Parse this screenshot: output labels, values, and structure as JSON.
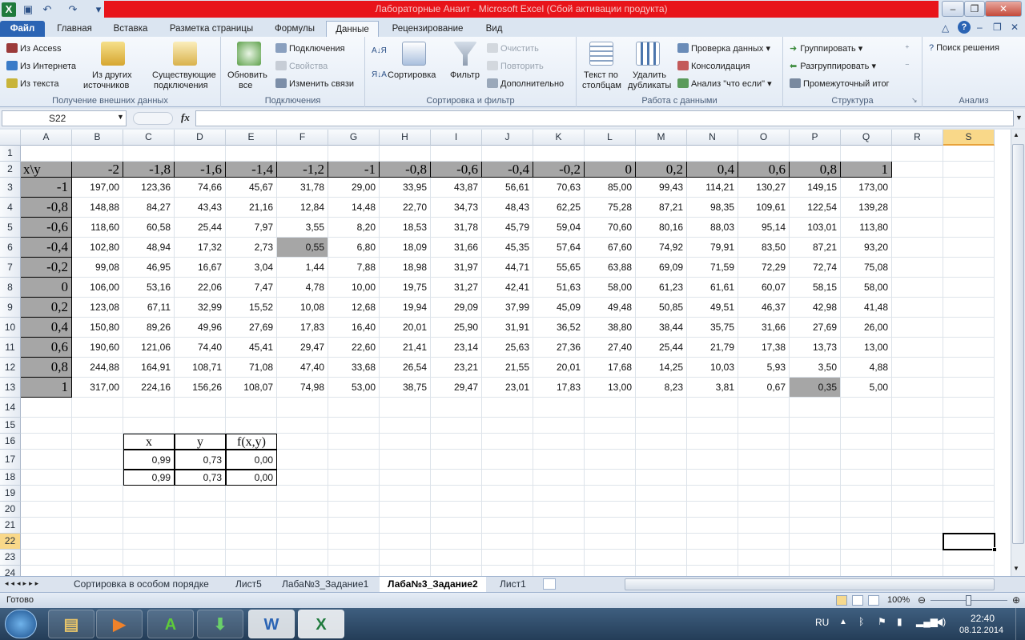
{
  "window": {
    "title": "Лабораторные Анаит - Microsoft Excel (Сбой активации продукта)"
  },
  "tabs": [
    "Файл",
    "Главная",
    "Вставка",
    "Разметка страницы",
    "Формулы",
    "Данные",
    "Рецензирование",
    "Вид"
  ],
  "ribbon": {
    "ext_data": {
      "access": "Из Access",
      "web": "Из Интернета",
      "text": "Из текста",
      "other1": "Из других",
      "other2": "источников",
      "existing1": "Существующие",
      "existing2": "подключения",
      "label": "Получение внешних данных"
    },
    "connections": {
      "refresh1": "Обновить",
      "refresh2": "все",
      "conn": "Подключения",
      "props": "Свойства",
      "links": "Изменить связи",
      "label": "Подключения"
    },
    "sort": {
      "sort": "Сортировка",
      "filter": "Фильтр",
      "clear": "Очистить",
      "reapply": "Повторить",
      "advanced": "Дополнительно",
      "label": "Сортировка и фильтр"
    },
    "tools": {
      "t2c1": "Текст по",
      "t2c2": "столбцам",
      "dup1": "Удалить",
      "dup2": "дубликаты",
      "validation": "Проверка данных",
      "consolidate": "Консолидация",
      "whatif": "Анализ \"что если\"",
      "label": "Работа с данными"
    },
    "outline": {
      "group": "Группировать",
      "ungroup": "Разгруппировать",
      "subtotal": "Промежуточный итог",
      "label": "Структура"
    },
    "analysis": {
      "solver": "Поиск решения",
      "label": "Анализ"
    }
  },
  "formula_bar": {
    "name_box": "S22",
    "fx": "fx"
  },
  "columns": [
    "A",
    "B",
    "C",
    "D",
    "E",
    "F",
    "G",
    "H",
    "I",
    "J",
    "K",
    "L",
    "M",
    "N",
    "O",
    "P",
    "Q",
    "R",
    "S"
  ],
  "rows": [
    "1",
    "2",
    "3",
    "4",
    "5",
    "6",
    "7",
    "8",
    "9",
    "10",
    "11",
    "12",
    "13",
    "14",
    "15",
    "16",
    "17",
    "18",
    "19",
    "20",
    "21",
    "22",
    "23",
    "24"
  ],
  "table": {
    "corner": "x\\y",
    "y_headers": [
      "-2",
      "-1,8",
      "-1,6",
      "-1,4",
      "-1,2",
      "-1",
      "-0,8",
      "-0,6",
      "-0,4",
      "-0,2",
      "0",
      "0,2",
      "0,4",
      "0,6",
      "0,8",
      "1"
    ],
    "x_headers": [
      "-1",
      "-0,8",
      "-0,6",
      "-0,4",
      "-0,2",
      "0",
      "0,2",
      "0,4",
      "0,6",
      "0,8",
      "1"
    ],
    "values": [
      [
        "197,00",
        "123,36",
        "74,66",
        "45,67",
        "31,78",
        "29,00",
        "33,95",
        "43,87",
        "56,61",
        "70,63",
        "85,00",
        "99,43",
        "114,21",
        "130,27",
        "149,15",
        "173,00"
      ],
      [
        "148,88",
        "84,27",
        "43,43",
        "21,16",
        "12,84",
        "14,48",
        "22,70",
        "34,73",
        "48,43",
        "62,25",
        "75,28",
        "87,21",
        "98,35",
        "109,61",
        "122,54",
        "139,28"
      ],
      [
        "118,60",
        "60,58",
        "25,44",
        "7,97",
        "3,55",
        "8,20",
        "18,53",
        "31,78",
        "45,79",
        "59,04",
        "70,60",
        "80,16",
        "88,03",
        "95,14",
        "103,01",
        "113,80"
      ],
      [
        "102,80",
        "48,94",
        "17,32",
        "2,73",
        "0,55",
        "6,80",
        "18,09",
        "31,66",
        "45,35",
        "57,64",
        "67,60",
        "74,92",
        "79,91",
        "83,50",
        "87,21",
        "93,20"
      ],
      [
        "99,08",
        "46,95",
        "16,67",
        "3,04",
        "1,44",
        "7,88",
        "18,98",
        "31,97",
        "44,71",
        "55,65",
        "63,88",
        "69,09",
        "71,59",
        "72,29",
        "72,74",
        "75,08"
      ],
      [
        "106,00",
        "53,16",
        "22,06",
        "7,47",
        "4,78",
        "10,00",
        "19,75",
        "31,27",
        "42,41",
        "51,63",
        "58,00",
        "61,23",
        "61,61",
        "60,07",
        "58,15",
        "58,00"
      ],
      [
        "123,08",
        "67,11",
        "32,99",
        "15,52",
        "10,08",
        "12,68",
        "19,94",
        "29,09",
        "37,99",
        "45,09",
        "49,48",
        "50,85",
        "49,51",
        "46,37",
        "42,98",
        "41,48"
      ],
      [
        "150,80",
        "89,26",
        "49,96",
        "27,69",
        "17,83",
        "16,40",
        "20,01",
        "25,90",
        "31,91",
        "36,52",
        "38,80",
        "38,44",
        "35,75",
        "31,66",
        "27,69",
        "26,00"
      ],
      [
        "190,60",
        "121,06",
        "74,40",
        "45,41",
        "29,47",
        "22,60",
        "21,41",
        "23,14",
        "25,63",
        "27,36",
        "27,40",
        "25,44",
        "21,79",
        "17,38",
        "13,73",
        "13,00"
      ],
      [
        "244,88",
        "164,91",
        "108,71",
        "71,08",
        "47,40",
        "33,68",
        "26,54",
        "23,21",
        "21,55",
        "20,01",
        "17,68",
        "14,25",
        "10,03",
        "5,93",
        "3,50",
        "4,88"
      ],
      [
        "317,00",
        "224,16",
        "156,26",
        "108,07",
        "74,98",
        "53,00",
        "38,75",
        "29,47",
        "23,01",
        "17,83",
        "13,00",
        "8,23",
        "3,81",
        "0,67",
        "0,35",
        "5,00"
      ]
    ]
  },
  "result": {
    "headers": [
      "x",
      "y",
      "f(x,y)"
    ],
    "rows": [
      [
        "0,99",
        "0,73",
        "0,00"
      ],
      [
        "0,99",
        "0,73",
        "0,00"
      ]
    ]
  },
  "sheets": [
    "Сортировка в особом порядке",
    "Лист5",
    "Лаба№3_Задание1",
    "Лаба№3_Задание2",
    "Лист1"
  ],
  "status": {
    "ready": "Готово",
    "zoom": "100%"
  },
  "taskbar": {
    "lang": "RU",
    "time": "22:40",
    "date": "08.12.2014"
  }
}
